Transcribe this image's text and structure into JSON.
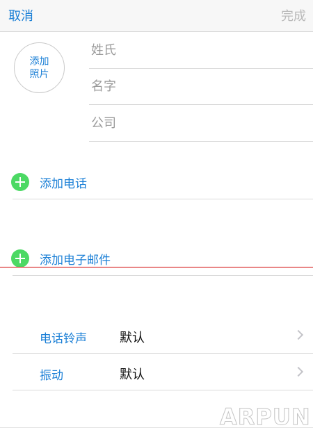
{
  "navbar": {
    "cancel_label": "取消",
    "done_label": "完成"
  },
  "contact": {
    "add_photo_label": "添加照片",
    "fields": [
      {
        "placeholder": "姓氏",
        "value": ""
      },
      {
        "placeholder": "名字",
        "value": ""
      },
      {
        "placeholder": "公司",
        "value": ""
      }
    ]
  },
  "actions": {
    "add_phone_label": "添加电话",
    "add_email_label": "添加电子邮件"
  },
  "settings": [
    {
      "label": "电话铃声",
      "value": "默认"
    },
    {
      "label": "振动",
      "value": "默认"
    }
  ],
  "watermark": "ARPUN",
  "colors": {
    "accent": "#1a7fd6",
    "add_button": "#4cd964",
    "disabled_text": "#b9b9b9",
    "annotation_line": "#d00000"
  },
  "icons": {
    "add": "plus-circle-icon",
    "disclosure": "chevron-right-icon"
  }
}
